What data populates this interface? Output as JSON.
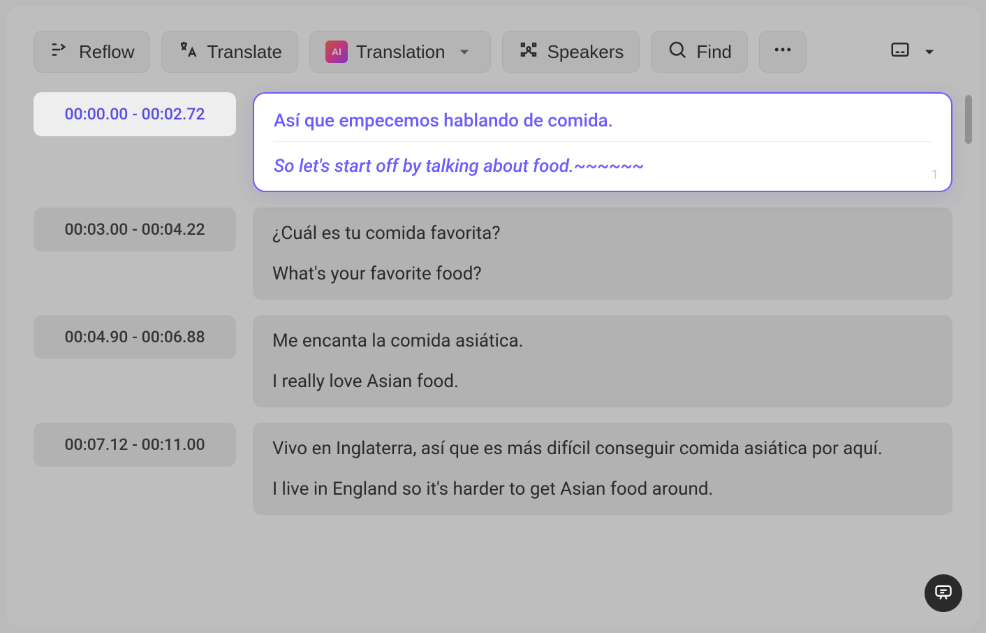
{
  "toolbar": {
    "reflow_label": "Reflow",
    "translate_label": "Translate",
    "translation_label": "Translation",
    "speakers_label": "Speakers",
    "find_label": "Find"
  },
  "segments": [
    {
      "time": "00:00.00 - 00:02.72",
      "src": "Así que empecemos hablando de comida.",
      "trg": "So let's start off by talking about food.~~~~~~",
      "index": "1",
      "active": true
    },
    {
      "time": "00:03.00 - 00:04.22",
      "src": "¿Cuál es tu comida favorita?",
      "trg": "What's your favorite food?",
      "active": false
    },
    {
      "time": "00:04.90 - 00:06.88",
      "src": "Me encanta la comida asiática.",
      "trg": "I really love Asian food.",
      "active": false
    },
    {
      "time": "00:07.12  -  00:11.00",
      "src": "Vivo en Inglaterra, así que es más difícil conseguir comida asiática por aquí.",
      "trg": "I live in England so it's harder to get Asian food around.",
      "active": false
    }
  ],
  "ai_badge": "AI"
}
